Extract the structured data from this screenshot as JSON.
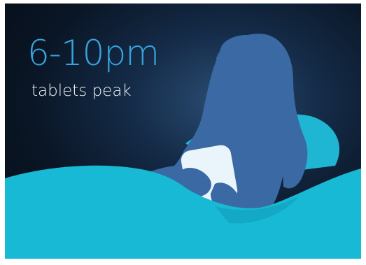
{
  "headline": "6-10pm",
  "subline": "tablets peak",
  "colors": {
    "background_center": "#2a4d74",
    "background_edge": "#050b14",
    "headline": "#36a5de",
    "subline": "#f2f6fa",
    "silhouette": "#3a69a3",
    "bedding": "#17b9d5",
    "tablet_screen": "#eaf4fb"
  },
  "illustration": "woman-silhouette-with-tablet-icon"
}
